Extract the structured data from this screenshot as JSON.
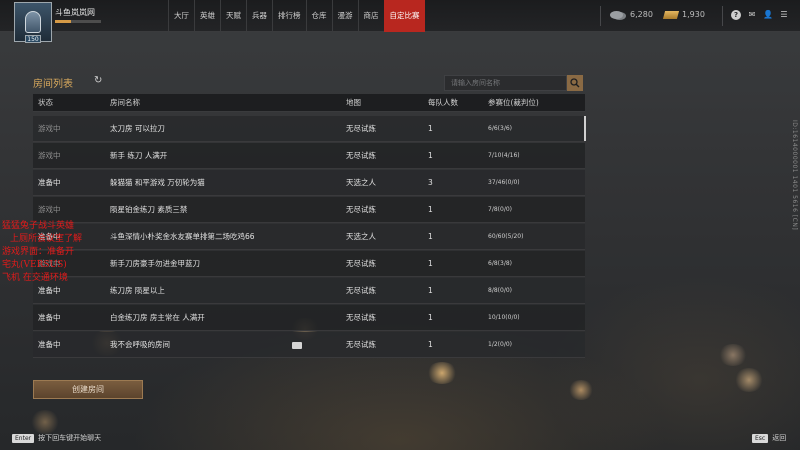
{
  "user": {
    "name": "斗鱼岚岚网",
    "level": "150",
    "exp_fraction": 0.35
  },
  "nav": {
    "items": [
      {
        "label": "大厅",
        "active": false
      },
      {
        "label": "英雄",
        "active": false
      },
      {
        "label": "天赋",
        "active": false
      },
      {
        "label": "兵器",
        "active": false
      },
      {
        "label": "排行榜",
        "active": false
      },
      {
        "label": "仓库",
        "active": false
      },
      {
        "label": "漫游",
        "active": false
      },
      {
        "label": "商店",
        "active": false
      },
      {
        "label": "自定比赛",
        "active": true
      }
    ]
  },
  "currency": {
    "silver": "6,280",
    "gold": "1,930"
  },
  "uid": "ID:1614000001 1401 5616 [CN]",
  "panel": {
    "title": "房间列表",
    "search_placeholder": "请输入房间名称",
    "columns": [
      "状态",
      "房间名称",
      "地图",
      "每队人数",
      "参赛位(裁判位)"
    ],
    "rows": [
      {
        "status": "游戏中",
        "state": "playing",
        "name": "太刀房 可以拉刀",
        "map": "无尽试炼",
        "team": "1",
        "slots": "6/6(3/6)"
      },
      {
        "status": "游戏中",
        "state": "playing",
        "name": "新手 练刀 人满开",
        "map": "无尽试炼",
        "team": "1",
        "slots": "7/10(4/16)"
      },
      {
        "status": "准备中",
        "state": "ready",
        "name": "躲猫猫 和平游戏 万仞轮为猫",
        "map": "天选之人",
        "team": "3",
        "slots": "37/46(0/0)"
      },
      {
        "status": "游戏中",
        "state": "playing",
        "name": "陨星铂金练刀 素质三禁",
        "map": "无尽试炼",
        "team": "1",
        "slots": "7/8(0/0)"
      },
      {
        "status": "准备中",
        "state": "ready",
        "name": "斗鱼深情小朴奖金水友赛单排第二场吃鸡66",
        "map": "天选之人",
        "team": "1",
        "slots": "60/60(5/20)"
      },
      {
        "status": "游戏中",
        "state": "playing",
        "name": "新手刀房豪手勿进金甲蓝刀",
        "map": "无尽试炼",
        "team": "1",
        "slots": "6/8(3/8)"
      },
      {
        "status": "准备中",
        "state": "ready",
        "name": "练刀房 陨星以上",
        "map": "无尽试炼",
        "team": "1",
        "slots": "8/8(0/0)"
      },
      {
        "status": "准备中",
        "state": "ready",
        "name": "白金练刀房  房主常在  人满开",
        "map": "无尽试炼",
        "team": "1",
        "slots": "10/10(0/0)"
      },
      {
        "status": "准备中",
        "state": "ready",
        "name": "我不会呼吸的房间",
        "map": "无尽试炼",
        "team": "1",
        "slots": "1/2(0/0)"
      }
    ],
    "create_button": "创建房间"
  },
  "overlay_chat": [
    "猛猛兔子战斗英雄",
    "上厕所会议室了解",
    "游戏界面：准备开",
    "宅丸(VERSUS)",
    "飞机 在交通环境"
  ],
  "hints": {
    "enter_key": "Enter",
    "enter_text": "按下回车键开始聊天",
    "esc_key": "Esc",
    "esc_text": "返回"
  }
}
